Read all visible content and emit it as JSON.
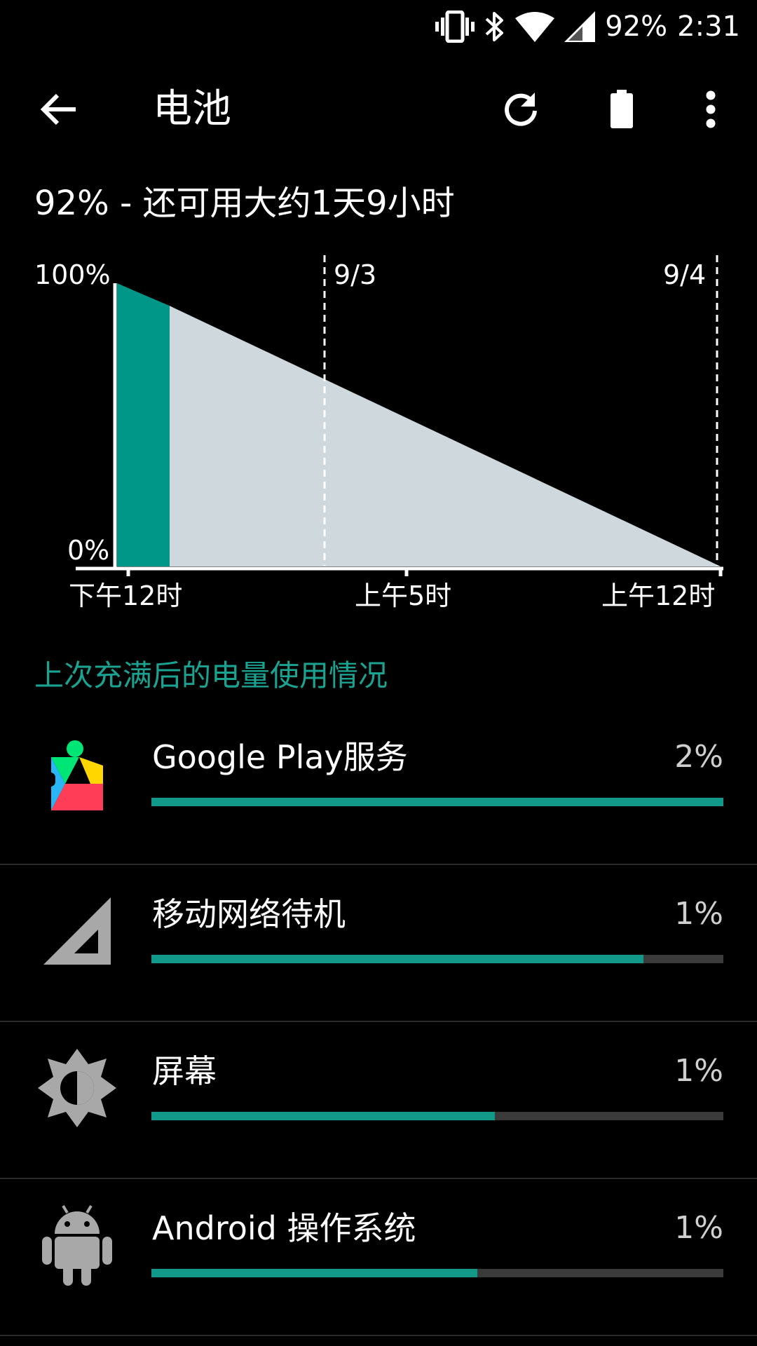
{
  "status_bar": {
    "battery_text": "92%",
    "time": "2:31",
    "icons": [
      "vibrate-icon",
      "bluetooth-icon",
      "wifi-icon",
      "signal-icon"
    ]
  },
  "toolbar": {
    "title": "电池",
    "back_icon": "arrow-back-icon",
    "actions": [
      "refresh-icon",
      "battery-saver-icon",
      "more-vert-icon"
    ]
  },
  "summary": "92% - 还可用大约1天9小时",
  "graph": {
    "y_max_label": "100%",
    "y_min_label": "0%",
    "date_labels": [
      "9/3",
      "9/4"
    ],
    "x_labels": [
      "下午12时",
      "上午5时",
      "上午12时"
    ],
    "colors": {
      "history": "#009688",
      "projection": "#cfd8dc",
      "axis": "#ffffff"
    }
  },
  "chart_data": {
    "type": "area",
    "title": "",
    "xlabel": "",
    "ylabel": "",
    "ylim": [
      0,
      100
    ],
    "series": [
      {
        "values": [
          100,
          98,
          96,
          94,
          92
        ]
      },
      {
        "values": [
          92,
          0
        ]
      }
    ]
  },
  "section_title": "上次充满后的电量使用情况",
  "usage_items": [
    {
      "name": "Google Play服务",
      "percent": "2%",
      "bar_fraction": 1.0,
      "icon": "google-play-services-icon"
    },
    {
      "name": "移动网络待机",
      "percent": "1%",
      "bar_fraction": 0.86,
      "icon": "cell-signal-icon"
    },
    {
      "name": "屏幕",
      "percent": "1%",
      "bar_fraction": 0.6,
      "icon": "brightness-icon"
    },
    {
      "name": "Android 操作系统",
      "percent": "1%",
      "bar_fraction": 0.57,
      "icon": "android-icon"
    }
  ],
  "colors": {
    "accent": "#1ba392",
    "bar_fill": "#11998a",
    "bar_track": "#3a3a3a"
  }
}
